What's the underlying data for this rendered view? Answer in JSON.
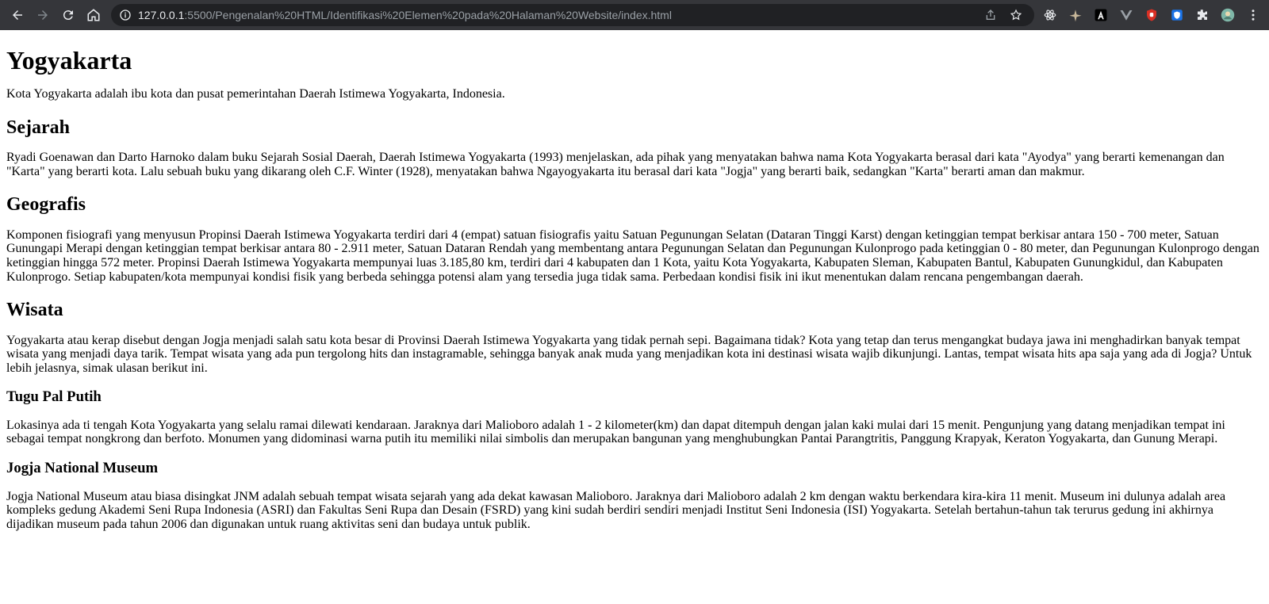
{
  "browser": {
    "url_host": "127.0.0.1",
    "url_path": ":5500/Pengenalan%20HTML/Identifikasi%20Elemen%20pada%20Halaman%20Website/index.html"
  },
  "page": {
    "title": "Yogyakarta",
    "intro": "Kota Yogyakarta adalah ibu kota dan pusat pemerintahan Daerah Istimewa Yogyakarta, Indonesia.",
    "sections": [
      {
        "heading": "Sejarah",
        "text": "Ryadi Goenawan dan Darto Harnoko dalam buku Sejarah Sosial Daerah, Daerah Istimewa Yogyakarta (1993) menjelaskan, ada pihak yang menyatakan bahwa nama Kota Yogyakarta berasal dari kata \"Ayodya\" yang berarti kemenangan dan \"Karta\" yang berarti kota. Lalu sebuah buku yang dikarang oleh C.F. Winter (1928), menyatakan bahwa Ngayogyakarta itu berasal dari kata \"Jogja\" yang berarti baik, sedangkan \"Karta\" berarti aman dan makmur."
      },
      {
        "heading": "Geografis",
        "text": "Komponen fisiografi yang menyusun Propinsi Daerah Istimewa Yogyakarta terdiri dari 4 (empat) satuan fisiografis yaitu Satuan Pegunungan Selatan (Dataran Tinggi Karst) dengan ketinggian tempat berkisar antara 150 - 700 meter, Satuan Gunungapi Merapi dengan ketinggian tempat berkisar antara 80 - 2.911 meter, Satuan Dataran Rendah yang membentang antara Pegunungan Selatan dan Pegunungan Kulonprogo pada ketinggian 0 - 80 meter, dan Pegunungan Kulonprogo dengan ketinggian hingga 572 meter. Propinsi Daerah Istimewa Yogyakarta mempunyai luas 3.185,80 km, terdiri dari 4 kabupaten dan 1 Kota, yaitu Kota Yogyakarta, Kabupaten Sleman, Kabupaten Bantul, Kabupaten Gunungkidul, dan Kabupaten Kulonprogo. Setiap kabupaten/kota mempunyai kondisi fisik yang berbeda sehingga potensi alam yang tersedia juga tidak sama. Perbedaan kondisi fisik ini ikut menentukan dalam rencana pengembangan daerah."
      },
      {
        "heading": "Wisata",
        "text": "Yogyakarta atau kerap disebut dengan Jogja menjadi salah satu kota besar di Provinsi Daerah Istimewa Yogyakarta yang tidak pernah sepi. Bagaimana tidak? Kota yang tetap dan terus mengangkat budaya jawa ini menghadirkan banyak tempat wisata yang menjadi daya tarik. Tempat wisata yang ada pun tergolong hits dan instagramable, sehingga banyak anak muda yang menjadikan kota ini destinasi wisata wajib dikunjungi. Lantas, tempat wisata hits apa saja yang ada di Jogja? Untuk lebih jelasnya, simak ulasan berikut ini."
      }
    ],
    "subsections": [
      {
        "heading": "Tugu Pal Putih",
        "text": "Lokasinya ada ti tengah Kota Yogyakarta yang selalu ramai dilewati kendaraan. Jaraknya dari Malioboro adalah 1 - 2 kilometer(km) dan dapat ditempuh dengan jalan kaki mulai dari 15 menit. Pengunjung yang datang menjadikan tempat ini sebagai tempat nongkrong dan berfoto. Monumen yang didominasi warna putih itu memiliki nilai simbolis dan merupakan bangunan yang menghubungkan Pantai Parangtritis, Panggung Krapyak, Keraton Yogyakarta, dan Gunung Merapi."
      },
      {
        "heading": "Jogja National Museum",
        "text": "Jogja National Museum atau biasa disingkat JNM adalah sebuah tempat wisata sejarah yang ada dekat kawasan Malioboro. Jaraknya dari Malioboro adalah 2 km dengan waktu berkendara kira-kira 11 menit. Museum ini dulunya adalah area kompleks gedung Akademi Seni Rupa Indonesia (ASRI) dan Fakultas Seni Rupa dan Desain (FSRD) yang kini sudah berdiri sendiri menjadi Institut Seni Indonesia (ISI) Yogyakarta. Setelah bertahun-tahun tak terurus gedung ini akhirnya dijadikan museum pada tahun 2006 dan digunakan untuk ruang aktivitas seni dan budaya untuk publik."
      }
    ]
  }
}
